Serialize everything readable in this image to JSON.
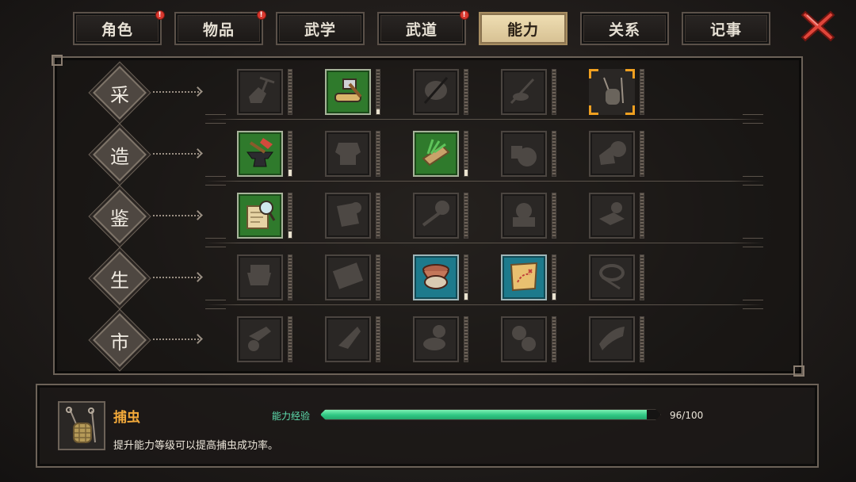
{
  "tabs": [
    {
      "label": "角色",
      "alert": true,
      "active": false
    },
    {
      "label": "物品",
      "alert": true,
      "active": false
    },
    {
      "label": "武学",
      "alert": false,
      "active": false
    },
    {
      "label": "武道",
      "alert": true,
      "active": false
    },
    {
      "label": "能力",
      "alert": false,
      "active": true
    },
    {
      "label": "关系",
      "alert": false,
      "active": false
    },
    {
      "label": "记事",
      "alert": false,
      "active": false
    }
  ],
  "alert_mark": "!",
  "close_icon": "close-x-icon",
  "colors": {
    "alert": "#d9382f",
    "selected": "#f0a020",
    "xp": "#2fc884",
    "name": "#f2a93a"
  },
  "categories": [
    {
      "label": "采",
      "skills": [
        {
          "icon": "mining-pick-icon",
          "state": "locked",
          "level": 0
        },
        {
          "icon": "logging-axe-icon",
          "state": "green",
          "level": 0.1
        },
        {
          "icon": "fishing-fish-icon",
          "state": "locked",
          "level": 0
        },
        {
          "icon": "fishing-rod-icon",
          "state": "locked",
          "level": 0
        },
        {
          "icon": "bug-catching-icon",
          "state": "selected",
          "level": 0
        }
      ]
    },
    {
      "label": "造",
      "skills": [
        {
          "icon": "smithing-anvil-icon",
          "state": "green",
          "level": 0.15
        },
        {
          "icon": "tailoring-armor-icon",
          "state": "locked",
          "level": 0
        },
        {
          "icon": "herb-cutting-icon",
          "state": "green",
          "level": 0.15
        },
        {
          "icon": "alchemy-pot-icon",
          "state": "locked",
          "level": 0
        },
        {
          "icon": "cooking-pot-icon",
          "state": "locked",
          "level": 0
        }
      ]
    },
    {
      "label": "鉴",
      "skills": [
        {
          "icon": "appraise-scroll-icon",
          "state": "green",
          "level": 0.15
        },
        {
          "icon": "appraise-armor-icon",
          "state": "locked",
          "level": 0
        },
        {
          "icon": "appraise-weapon-icon",
          "state": "locked",
          "level": 0
        },
        {
          "icon": "appraise-antique-icon",
          "state": "locked",
          "level": 0
        },
        {
          "icon": "appraise-book-icon",
          "state": "locked",
          "level": 0
        }
      ]
    },
    {
      "label": "生",
      "skills": [
        {
          "icon": "cooking-wok-icon",
          "state": "locked",
          "level": 0
        },
        {
          "icon": "abacus-icon",
          "state": "locked",
          "level": 0
        },
        {
          "icon": "medicine-bowl-icon",
          "state": "blue",
          "level": 0.15
        },
        {
          "icon": "treasure-map-icon",
          "state": "blue",
          "level": 0.15
        },
        {
          "icon": "rope-whip-icon",
          "state": "locked",
          "level": 0
        }
      ]
    },
    {
      "label": "市",
      "skills": [
        {
          "icon": "pickpocket-hand-icon",
          "state": "locked",
          "level": 0
        },
        {
          "icon": "bargain-hand-icon",
          "state": "locked",
          "level": 0
        },
        {
          "icon": "gambling-bowl-icon",
          "state": "locked",
          "level": 0
        },
        {
          "icon": "mechanism-gear-icon",
          "state": "locked",
          "level": 0
        },
        {
          "icon": "horn-icon",
          "state": "locked",
          "level": 0
        }
      ]
    }
  ],
  "selected_skill": {
    "icon": "bug-catching-icon",
    "name": "捕虫",
    "xp_label": "能力经验",
    "xp_current": 96,
    "xp_max": 100,
    "xp_text": "96/100",
    "description": "提升能力等级可以提高捕虫成功率。"
  }
}
